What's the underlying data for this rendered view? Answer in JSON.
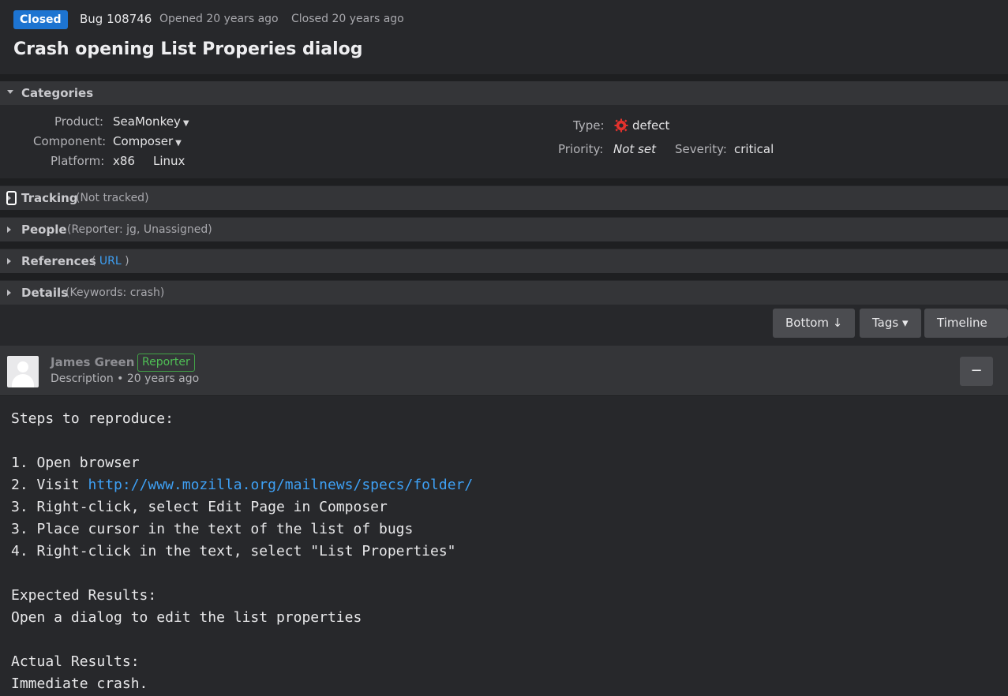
{
  "header": {
    "status": "Closed",
    "bug_id": "Bug 108746",
    "opened": "Opened 20 years ago",
    "closed": "Closed 20 years ago",
    "title": "Crash opening List Properies dialog",
    "status_color": "#1d74d1"
  },
  "categories": {
    "title": "Categories",
    "product_label": "Product:",
    "product": "SeaMonkey",
    "component_label": "Component:",
    "component": "Composer",
    "platform_label": "Platform:",
    "platform_arch": "x86",
    "platform_os": "Linux",
    "type_label": "Type:",
    "type": "defect",
    "type_icon": "defect-bug-icon",
    "priority_label": "Priority:",
    "priority": "Not set",
    "severity_label": "Severity:",
    "severity": "critical"
  },
  "tracking": {
    "title": "Tracking",
    "sub": "(Not tracked)"
  },
  "people": {
    "title": "People",
    "sub": "(Reporter: jg, Unassigned)"
  },
  "references": {
    "title": "References",
    "open": "(",
    "link": "URL",
    "close": ")"
  },
  "details": {
    "title": "Details",
    "sub": "(Keywords: crash)"
  },
  "toolbar": {
    "bottom": "Bottom ↓",
    "tags": "Tags ▾",
    "timeline": "Timeline ▾"
  },
  "comment": {
    "author": "James Green",
    "role": "Reporter",
    "meta": "Description • 20 years ago",
    "collapse": "−",
    "lines": {
      "l1": "Steps to reproduce:",
      "l2": "1. Open browser",
      "l3_prefix": "2. Visit ",
      "l3_link": "http://www.mozilla.org/mailnews/specs/folder/",
      "l4": "3. Right-click, select Edit Page in Composer",
      "l5": "3. Place cursor in the text of the list of bugs",
      "l6": "4. Right-click in the text, select \"List Properties\"",
      "l7": "Expected Results:",
      "l8": "Open a dialog to edit the list properties",
      "l9": "Actual Results:",
      "l10": "Immediate crash."
    }
  }
}
